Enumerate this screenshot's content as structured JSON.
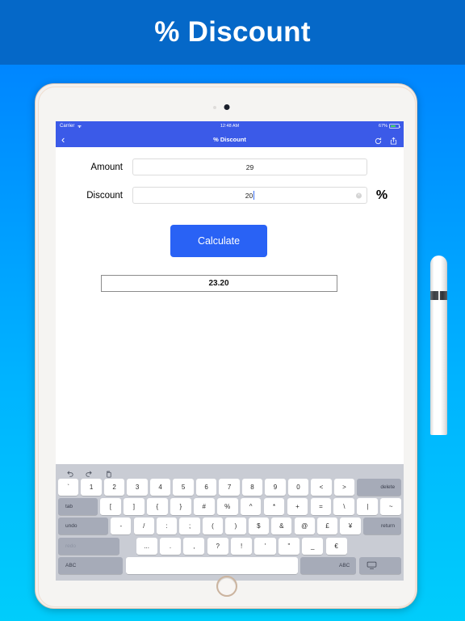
{
  "banner": {
    "title": "% Discount"
  },
  "device": {
    "type": "ipad",
    "camera_icon": "camera-dot",
    "home_button_icon": "home-button",
    "pencil_icon": "apple-pencil"
  },
  "status_bar": {
    "carrier": "Carrier",
    "wifi_icon": "wifi-icon",
    "time": "12:48 AM",
    "battery_percent": "67%",
    "battery_icon": "battery-icon",
    "battery_level": 67
  },
  "nav_bar": {
    "back_icon": "chevron-left-icon",
    "title": "% Discount",
    "refresh_icon": "refresh-icon",
    "share_icon": "share-icon",
    "background": "#3b5ae8"
  },
  "form": {
    "amount": {
      "label": "Amount",
      "value": "29",
      "placeholder": ""
    },
    "discount": {
      "label": "Discount",
      "value": "20",
      "placeholder": "",
      "clear_icon": "clear-circle-icon",
      "unit": "%"
    },
    "calculate_label": "Calculate",
    "calculate_color": "#2962f5",
    "result": {
      "value": "23.20"
    }
  },
  "keyboard": {
    "toolbar": [
      {
        "name": "undo-icon",
        "label": "undo"
      },
      {
        "name": "redo-icon",
        "label": "redo"
      },
      {
        "name": "paste-icon",
        "label": "paste"
      }
    ],
    "rows": [
      [
        {
          "label": "`",
          "style": "light"
        },
        {
          "label": "1",
          "style": "light"
        },
        {
          "label": "2",
          "style": "light"
        },
        {
          "label": "3",
          "style": "light"
        },
        {
          "label": "4",
          "style": "light"
        },
        {
          "label": "5",
          "style": "light"
        },
        {
          "label": "6",
          "style": "light"
        },
        {
          "label": "7",
          "style": "light"
        },
        {
          "label": "8",
          "style": "light"
        },
        {
          "label": "9",
          "style": "light"
        },
        {
          "label": "0",
          "style": "light"
        },
        {
          "label": "<",
          "style": "light"
        },
        {
          "label": ">",
          "style": "light"
        },
        {
          "label": "delete",
          "style": "dark",
          "wide": "k-del"
        }
      ],
      [
        {
          "label": "tab",
          "style": "dark",
          "wide": "k-tab"
        },
        {
          "label": "[",
          "style": "light"
        },
        {
          "label": "]",
          "style": "light"
        },
        {
          "label": "{",
          "style": "light"
        },
        {
          "label": "}",
          "style": "light"
        },
        {
          "label": "#",
          "style": "light"
        },
        {
          "label": "%",
          "style": "light"
        },
        {
          "label": "^",
          "style": "light"
        },
        {
          "label": "*",
          "style": "light"
        },
        {
          "label": "+",
          "style": "light"
        },
        {
          "label": "=",
          "style": "light"
        },
        {
          "label": "\\",
          "style": "light"
        },
        {
          "label": "|",
          "style": "light"
        },
        {
          "label": "~",
          "style": "light"
        }
      ],
      [
        {
          "label": "undo",
          "style": "dark",
          "wide": "k-undo"
        },
        {
          "label": "-",
          "style": "light"
        },
        {
          "label": "/",
          "style": "light"
        },
        {
          "label": ":",
          "style": "light"
        },
        {
          "label": ";",
          "style": "light"
        },
        {
          "label": "(",
          "style": "light"
        },
        {
          "label": ")",
          "style": "light"
        },
        {
          "label": "$",
          "style": "light"
        },
        {
          "label": "&",
          "style": "light"
        },
        {
          "label": "@",
          "style": "light"
        },
        {
          "label": "£",
          "style": "light"
        },
        {
          "label": "¥",
          "style": "light"
        },
        {
          "label": "return",
          "style": "dark",
          "wide": "k-ret"
        }
      ],
      [
        {
          "label": "redo",
          "style": "dark muted",
          "wide": "k-redo"
        },
        {
          "label": "",
          "style": "blank",
          "wide": "k-r4pad"
        },
        {
          "label": "...",
          "style": "light"
        },
        {
          "label": ".",
          "style": "light"
        },
        {
          "label": ",",
          "style": "light"
        },
        {
          "label": "?",
          "style": "light"
        },
        {
          "label": "!",
          "style": "light"
        },
        {
          "label": "'",
          "style": "light"
        },
        {
          "label": "\"",
          "style": "light"
        },
        {
          "label": "_",
          "style": "light"
        },
        {
          "label": "€",
          "style": "light"
        },
        {
          "label": "",
          "style": "blank",
          "wide": "k-r4end"
        }
      ],
      [
        {
          "label": "ABC",
          "style": "dark",
          "wide": "k-abc"
        },
        {
          "label": "",
          "style": "light",
          "wide": "k-space"
        },
        {
          "label": "ABC",
          "style": "dark",
          "wide": "k-abc2"
        },
        {
          "label": "",
          "style": "dark",
          "wide": "k-dismiss",
          "icon": "keyboard-dismiss-icon"
        }
      ]
    ]
  }
}
